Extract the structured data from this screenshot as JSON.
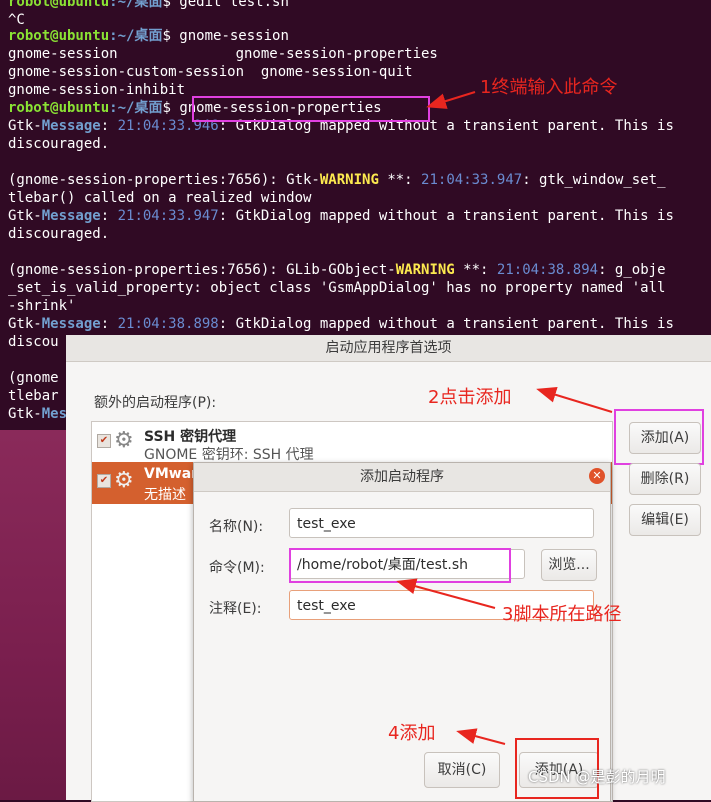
{
  "terminal": {
    "lines": [
      {
        "parts": [
          "robot@ubuntu",
          ":~/桌面",
          "$ gedit test.sh"
        ]
      },
      {
        "text": "^C"
      },
      {
        "parts": [
          "robot@ubuntu",
          ":~/桌面",
          "$ gnome-session"
        ]
      },
      {
        "text": "gnome-session              gnome-session-properties"
      },
      {
        "text": "gnome-session-custom-session  gnome-session-quit"
      },
      {
        "text": "gnome-session-inhibit"
      },
      {
        "parts": [
          "robot@ubuntu",
          ":~/桌面",
          "$ ",
          "gnome-session-properties"
        ]
      },
      {
        "parts": [
          "Gtk-",
          "Message",
          ": ",
          "21:04:33.946",
          ": GtkDialog mapped without a transient parent. This is"
        ]
      },
      {
        "text": "discouraged."
      },
      {
        "text": ""
      },
      {
        "parts": [
          "(gnome-session-properties:7656): Gtk-",
          "WARNING",
          " **: ",
          "21:04:33.947",
          ": gtk_window_set_"
        ]
      },
      {
        "text": "tlebar() called on a realized window"
      },
      {
        "parts": [
          "Gtk-",
          "Message",
          ": ",
          "21:04:33.947",
          ": GtkDialog mapped without a transient parent. This is"
        ]
      },
      {
        "text": "discouraged."
      },
      {
        "text": ""
      },
      {
        "parts": [
          "(gnome-session-properties:7656): GLib-GObject-",
          "WARNING",
          " **: ",
          "21:04:38.894",
          ": g_obje"
        ]
      },
      {
        "text": "_set_is_valid_property: object class 'GsmAppDialog' has no property named 'all"
      },
      {
        "text": "-shrink'"
      },
      {
        "parts": [
          "Gtk-",
          "Message",
          ": ",
          "21:04:38.898",
          ": GtkDialog mapped without a transient parent. This is"
        ]
      },
      {
        "text": "discou"
      },
      {
        "text": ""
      },
      {
        "text": "(gnome"
      },
      {
        "text": "tlebar"
      },
      {
        "parts": [
          "Gtk-",
          "Mes"
        ]
      }
    ]
  },
  "startup_window": {
    "title": "启动应用程序首选项",
    "list_label": "额外的启动程序(P):",
    "apps": [
      {
        "name": "SSH 密钥代理",
        "desc": "GNOME 密钥环: SSH 代理",
        "checked": true,
        "selected": false
      },
      {
        "name": "VMware",
        "desc": "无描述",
        "checked": true,
        "selected": true
      }
    ],
    "buttons": {
      "add": "添加(A)",
      "remove": "删除(R)",
      "edit": "编辑(E)"
    }
  },
  "add_dialog": {
    "title": "添加启动程序",
    "name_label": "名称(N):",
    "name_value": "test_exe",
    "command_label": "命令(M):",
    "command_value": "/home/robot/桌面/test.sh",
    "browse_label": "浏览...",
    "comment_label": "注释(E):",
    "comment_value": "test_exe",
    "cancel_label": "取消(C)",
    "add_label": "添加(A)"
  },
  "annotations": {
    "step1": "1终端输入此命令",
    "step2": "2点击添加",
    "step3": "3脚本所在路径",
    "step4": "4添加"
  },
  "watermark": "CSDN @是彭的月明",
  "colors": {
    "terminal_bg": "#300a24",
    "highlight": "#e040e0",
    "annotation": "#e8261f",
    "selection": "#d4602e"
  }
}
